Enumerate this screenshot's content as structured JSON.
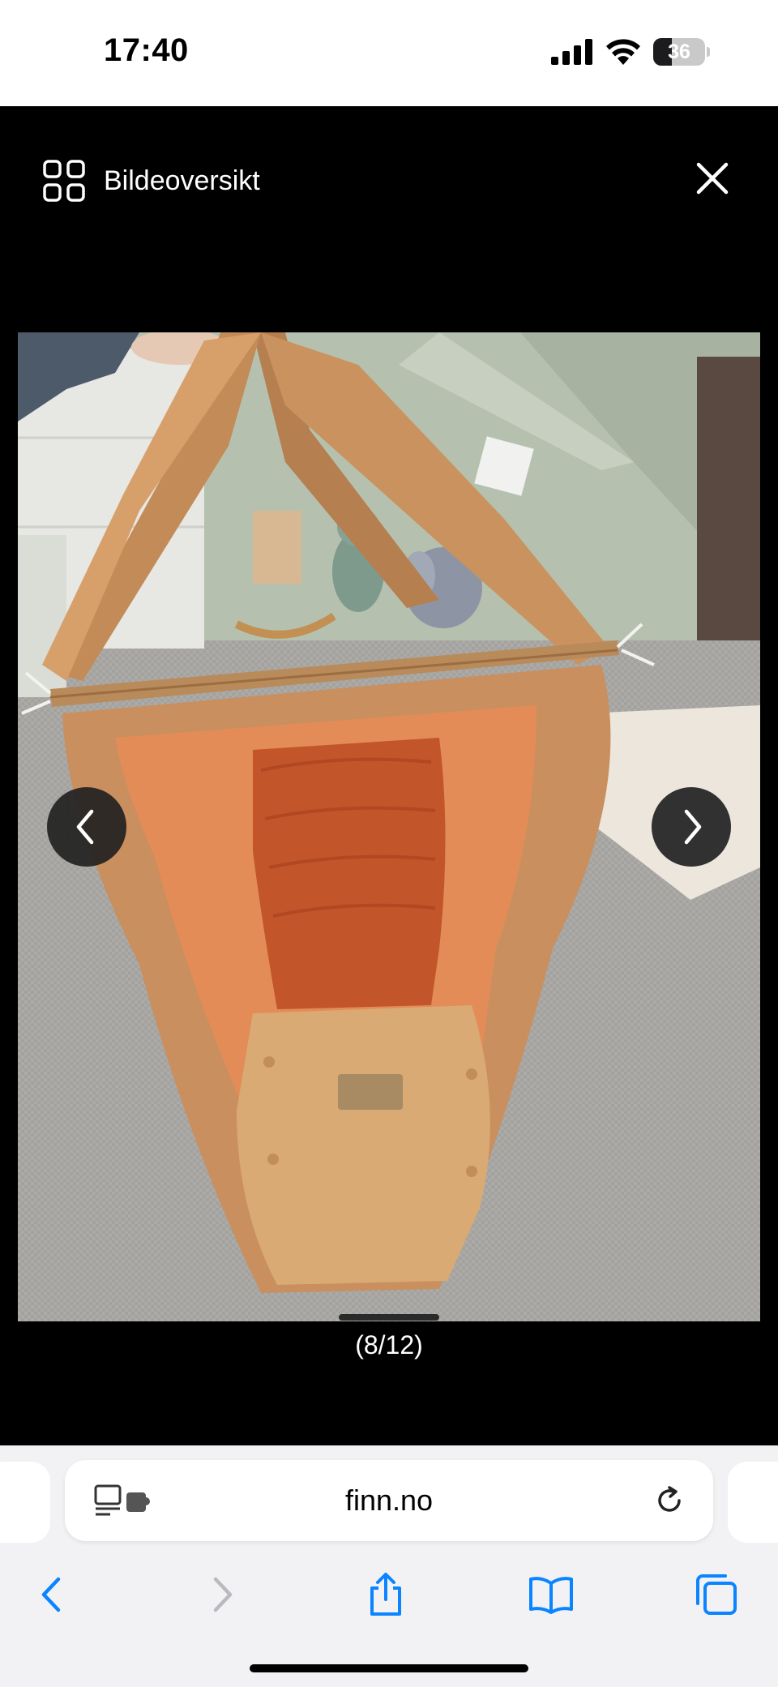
{
  "status_bar": {
    "time": "17:40",
    "battery_level": "36",
    "battery_fraction": 0.36,
    "icons": [
      "signal-icon",
      "wifi-icon",
      "battery-icon"
    ]
  },
  "viewer": {
    "overview_label": "Bildeoversikt",
    "overview_icon": "grid-icon",
    "close_icon": "close-icon",
    "prev_icon": "chevron-left-icon",
    "next_icon": "chevron-right-icon",
    "counter": "(8/12)"
  },
  "browser": {
    "url": "finn.no",
    "reader_icon": "reader-extension-icon",
    "reload_icon": "reload-icon",
    "toolbar": [
      "back-icon",
      "forward-icon",
      "share-icon",
      "bookmarks-icon",
      "tabs-icon"
    ]
  },
  "colors": {
    "background": "#000000",
    "chrome": "#f2f2f4",
    "accent": "#0a84ff",
    "fabric": "#c98f5e",
    "fabric_inner": "#c2552a",
    "carpet": "#a9a7a3",
    "wall": "#b8c4b0"
  }
}
